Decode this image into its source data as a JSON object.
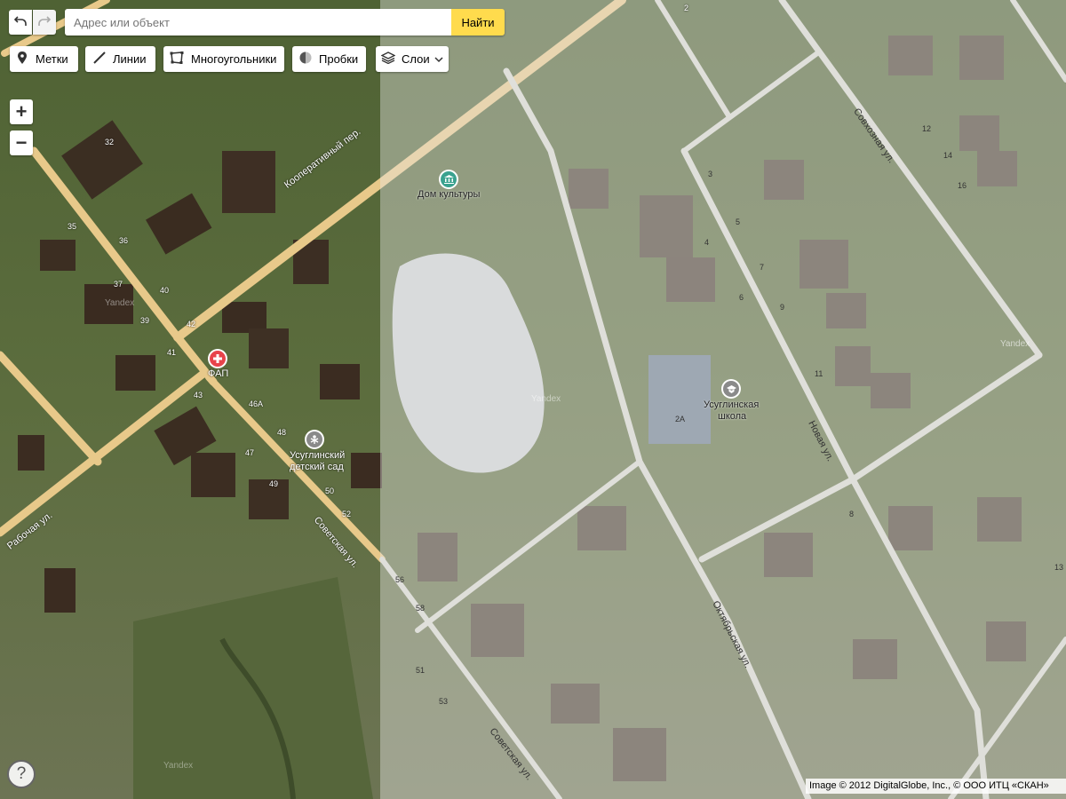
{
  "toolbar": {
    "undo_icon": "undo-icon",
    "redo_icon": "redo-icon",
    "search_placeholder": "Адрес или объект",
    "search_button": "Найти",
    "search_button_color": "#ffdb4d",
    "tools": [
      "Метки",
      "Линии",
      "Многоугольники",
      "Пробки",
      "Слои"
    ]
  },
  "zoom": {
    "plus": "+",
    "minus": "−"
  },
  "help": {
    "label": "?"
  },
  "map": {
    "left_layer": "satellite",
    "right_layer": "hybrid-faded",
    "streets": {
      "koop": "Кооперативный пер.",
      "sovkhoz": "Совхозная ул.",
      "novaya": "Новая ул.",
      "oktyabr": "Октябрьская ул.",
      "sovetskaya_top": "Советская ул.",
      "sovetskaya_bottom": "Советская ул.",
      "rabochaya": "Рабочая ул."
    },
    "pois": {
      "dk": "Дом культуры",
      "fap": "ФАП",
      "sad_line1": "Усуглинский",
      "sad_line2": "детский сад",
      "school_line1": "Усуглинская",
      "school_line2": "школа"
    },
    "house_numbers": [
      "32",
      "35",
      "36",
      "37",
      "39",
      "40",
      "41",
      "42",
      "43",
      "46А",
      "47",
      "48",
      "49",
      "50",
      "52",
      "2А",
      "3",
      "4",
      "5",
      "6",
      "7",
      "8",
      "9",
      "11",
      "12",
      "14",
      "16",
      "56",
      "58",
      "51",
      "53",
      "2",
      "13"
    ],
    "watermark": "Yandex",
    "copyright": "Image © 2012 DigitalGlobe, Inc., © ООО ИТЦ «СКАН»"
  },
  "colors": {
    "road": "#e8c98a",
    "road_faded": "#d9d9d3",
    "poi_red": "#e8434b",
    "poi_green": "#3aa28f",
    "poi_gray": "#8a8a8a"
  }
}
